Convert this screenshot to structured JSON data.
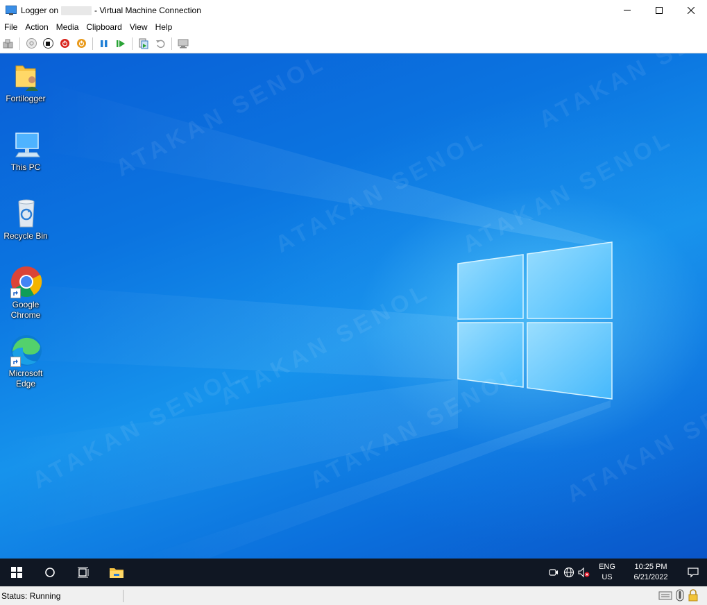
{
  "window": {
    "title_prefix": "Logger on",
    "title_suffix": "- Virtual Machine Connection"
  },
  "menu": [
    "File",
    "Action",
    "Media",
    "Clipboard",
    "View",
    "Help"
  ],
  "toolbar": {
    "buttons": [
      "ctrl-alt-del-icon",
      "start-icon",
      "turn-off-icon",
      "shutdown-icon",
      "save-state-icon",
      "pause-icon",
      "reset-icon",
      "checkpoint-icon",
      "revert-icon",
      "enhanced-session-icon"
    ]
  },
  "desktop": {
    "icons": [
      {
        "name": "fortilogger",
        "label": "Fortilogger"
      },
      {
        "name": "this-pc",
        "label": "This PC"
      },
      {
        "name": "recycle-bin",
        "label": "Recycle Bin"
      },
      {
        "name": "google-chrome",
        "label_line1": "Google",
        "label_line2": "Chrome"
      },
      {
        "name": "microsoft-edge",
        "label_line1": "Microsoft",
        "label_line2": "Edge"
      }
    ],
    "watermark": "ATAKAN SENOL"
  },
  "taskbar": {
    "language_line1": "ENG",
    "language_line2": "US",
    "time": "10:25 PM",
    "date": "6/21/2022"
  },
  "statusbar": {
    "status": "Status: Running"
  },
  "colors": {
    "taskbar_bg": "#101723",
    "desktop_accent": "#0b74e0",
    "folder_yellow": "#f6c343"
  }
}
